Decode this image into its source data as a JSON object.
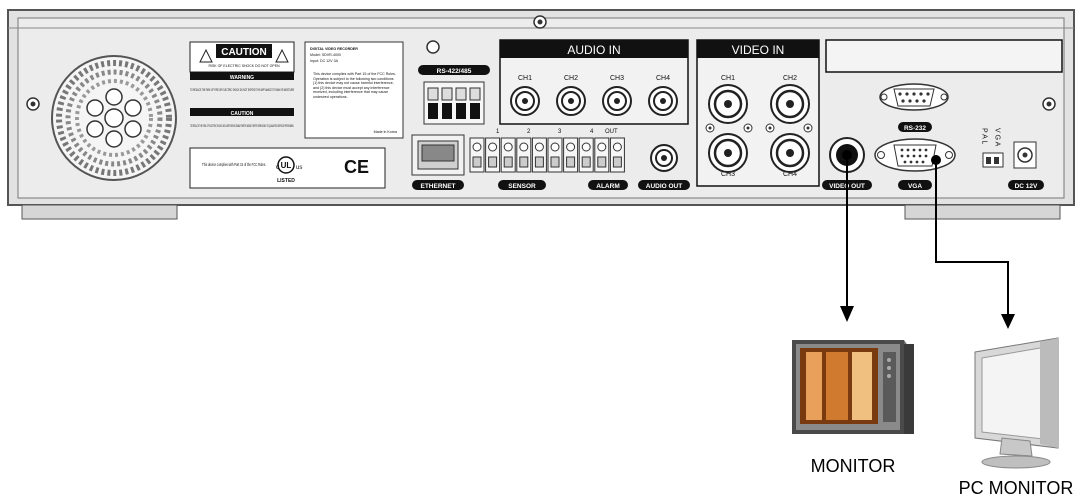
{
  "device": {
    "caution_title": "CAUTION",
    "caution_sub": "RISK OF ELECTRIC SHOCK DO NOT OPEN",
    "warning_title": "WARNING",
    "warning_text": "TO REDUCE THE RISK OF FIRE OR ELECTRIC SHOCK DO NOT EXPOSE THIS APPLIANCE TO RAIN OR MOISTURE",
    "caution2_title": "CAUTION",
    "caution2_text": "TO REDUCE THE RISK OF ELECTRIC SHOCK NO USER SERVICEABLE PARTS INSIDE. REFER SERVICING TO QUALIFIED SERVICE PERSONNEL",
    "fcc_text": "This device complies with Part 15 of the FCC Rules.",
    "listed": "LISTED",
    "info_head": "DIGITAL VIDEO RECORDER",
    "info_model": "Model: SDVR-4000",
    "info_input": "Input: DC 12V 3A",
    "info_body": "This device complies with Part 15 of the FCC Rules. Operation is subject to the following two conditions (1) this device may not cause harmful interference, and (2) this device must accept any interference received, including interference that may cause undesired operations.",
    "info_made": "Made in Korea",
    "rs422": "RS-422/485",
    "ethernet": "ETHERNET",
    "sensor": "SENSOR",
    "alarm": "ALARM",
    "audio_out": "AUDIO OUT",
    "audio_in": "AUDIO IN",
    "audio_channels": [
      "CH1",
      "CH2",
      "CH3",
      "CH4"
    ],
    "video_in": "VIDEO IN",
    "video_channels": [
      "CH1",
      "CH2",
      "CH3",
      "CH4"
    ],
    "video_out": "VIDEO OUT",
    "vga": "VGA",
    "rs232": "RS-232",
    "pal_letters": "P A L",
    "vga_letters": "V G A",
    "dc": "DC 12V",
    "sensor_numbers": [
      "1",
      "2",
      "3",
      "4"
    ],
    "out_label": "OUT"
  },
  "targets": {
    "monitor": "MONITOR",
    "pc_monitor": "PC MONITOR"
  },
  "colors": {
    "panel": "#e9e9e9",
    "label_bg": "#111111",
    "arrow": "#000000"
  }
}
